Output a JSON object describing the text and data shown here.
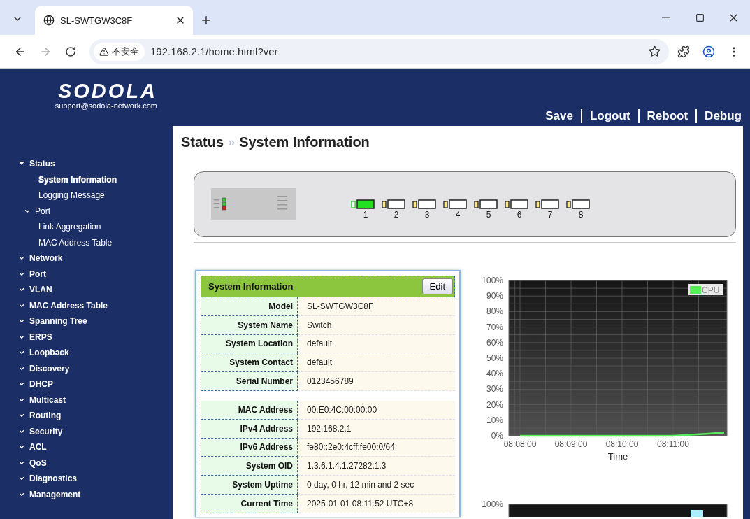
{
  "browser": {
    "tab_title": "SL-SWTGW3C8F",
    "security_label": "不安全",
    "url": "192.168.2.1/home.html?ver"
  },
  "header": {
    "logo": "SODOLA",
    "email": "support@sodola-network.com",
    "links": [
      "Save",
      "Logout",
      "Reboot",
      "Debug"
    ]
  },
  "sidebar": {
    "items": [
      {
        "label": "Status",
        "expanded": true,
        "children": [
          {
            "label": "System Information",
            "kind": "page",
            "selected": true
          },
          {
            "label": "Logging Message",
            "kind": "page",
            "selected": false
          },
          {
            "label": "Port",
            "kind": "folder",
            "selected": false
          },
          {
            "label": "Link Aggregation",
            "kind": "page",
            "selected": false
          },
          {
            "label": "MAC Address Table",
            "kind": "page",
            "selected": false
          }
        ]
      },
      {
        "label": "Network",
        "expanded": false
      },
      {
        "label": "Port",
        "expanded": false
      },
      {
        "label": "VLAN",
        "expanded": false
      },
      {
        "label": "MAC Address Table",
        "expanded": false
      },
      {
        "label": "Spanning Tree",
        "expanded": false
      },
      {
        "label": "ERPS",
        "expanded": false
      },
      {
        "label": "Loopback",
        "expanded": false
      },
      {
        "label": "Discovery",
        "expanded": false
      },
      {
        "label": "DHCP",
        "expanded": false
      },
      {
        "label": "Multicast",
        "expanded": false
      },
      {
        "label": "Routing",
        "expanded": false
      },
      {
        "label": "Security",
        "expanded": false
      },
      {
        "label": "ACL",
        "expanded": false
      },
      {
        "label": "QoS",
        "expanded": false
      },
      {
        "label": "Diagnostics",
        "expanded": false
      },
      {
        "label": "Management",
        "expanded": false
      }
    ]
  },
  "breadcrumb": {
    "items": [
      "Status",
      "System Information"
    ],
    "separator": "»"
  },
  "ports": [
    {
      "label": "1",
      "link_up": true
    },
    {
      "label": "2",
      "link_up": false
    },
    {
      "label": "3",
      "link_up": false
    },
    {
      "label": "4",
      "link_up": false
    },
    {
      "label": "5",
      "link_up": false
    },
    {
      "label": "6",
      "link_up": false
    },
    {
      "label": "7",
      "link_up": false
    },
    {
      "label": "8",
      "link_up": false
    }
  ],
  "system_info": {
    "title": "System Information",
    "edit_button": "Edit",
    "groups": [
      [
        {
          "label": "Model",
          "value": "SL-SWTGW3C8F"
        },
        {
          "label": "System Name",
          "value": "Switch"
        },
        {
          "label": "System Location",
          "value": "default"
        },
        {
          "label": "System Contact",
          "value": "default"
        },
        {
          "label": "Serial Number",
          "value": "0123456789"
        }
      ],
      [
        {
          "label": "MAC Address",
          "value": "00:E0:4C:00:00:00"
        },
        {
          "label": "IPv4 Address",
          "value": "192.168.2.1"
        },
        {
          "label": "IPv6 Address",
          "value": "fe80::2e0:4cff:fe00:0/64"
        },
        {
          "label": "System OID",
          "value": "1.3.6.1.4.1.27282.1.3"
        },
        {
          "label": "System Uptime",
          "value": "0 day, 0 hr, 12 min and 2 sec"
        },
        {
          "label": "Current Time",
          "value": "2025-01-01 08:11:52 UTC+8"
        }
      ]
    ]
  },
  "cpu_chart": {
    "chart_data": {
      "type": "line",
      "xlabel": "Time",
      "categories": [
        "08:08:00",
        "08:09:00",
        "08:10:00",
        "08:11:00",
        null
      ],
      "series": [
        {
          "name": "CPU",
          "color": "#55ee55",
          "values": [
            0,
            0,
            0,
            0,
            2
          ]
        }
      ],
      "ylim": [
        0,
        100
      ],
      "grid": true,
      "yticks": [
        {
          "value": 0,
          "label": "0%"
        },
        {
          "value": 10,
          "label": "10%"
        },
        {
          "value": 20,
          "label": "20%"
        },
        {
          "value": 30,
          "label": "30%"
        },
        {
          "value": 40,
          "label": "40%"
        },
        {
          "value": 50,
          "label": "50%"
        },
        {
          "value": 60,
          "label": "60%"
        },
        {
          "value": 70,
          "label": "70%"
        },
        {
          "value": 80,
          "label": "80%"
        },
        {
          "value": 90,
          "label": "90%"
        },
        {
          "value": 100,
          "label": "100%"
        }
      ]
    }
  },
  "mem_chart": {
    "top_tick": "100%"
  }
}
